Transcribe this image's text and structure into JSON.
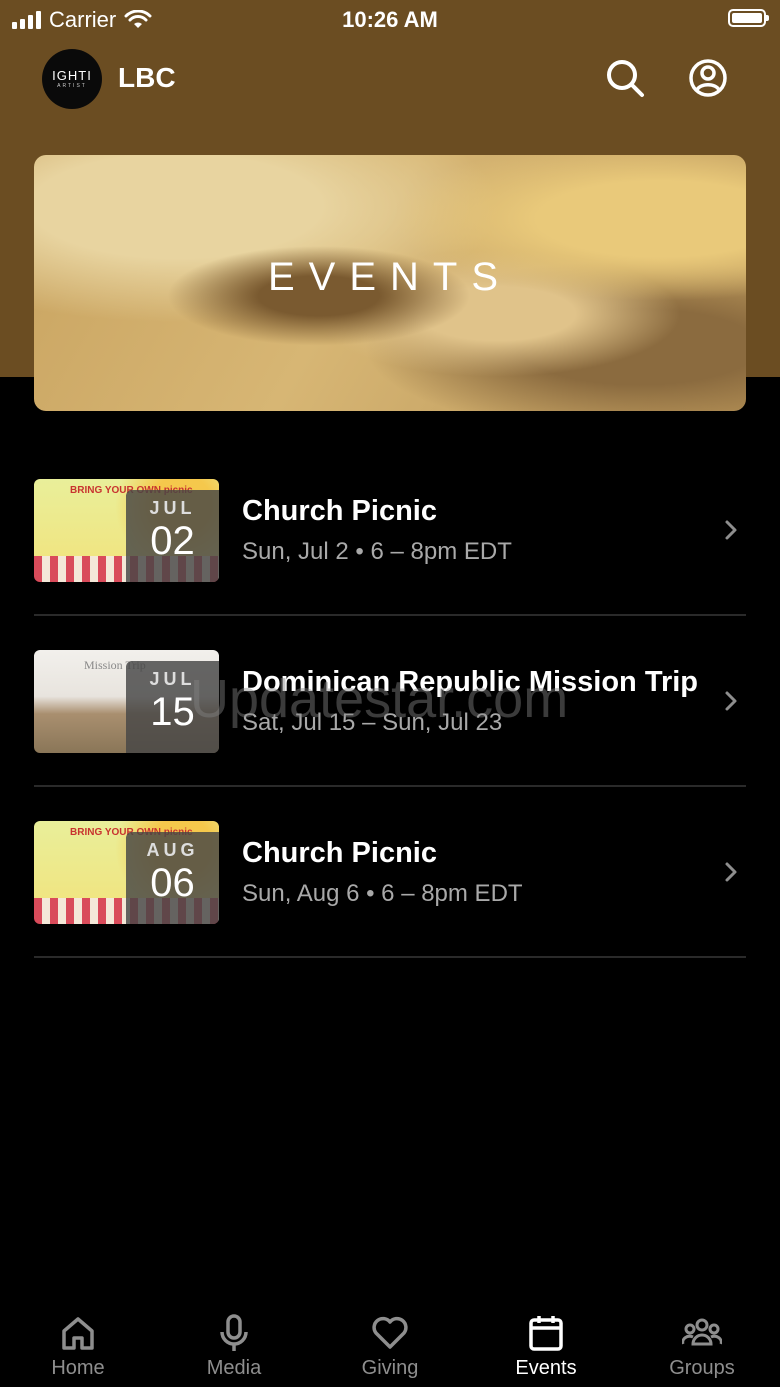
{
  "status_bar": {
    "carrier": "Carrier",
    "time": "10:26 AM"
  },
  "app_bar": {
    "logo_text": "IGHTI",
    "logo_subtext": "ARTIST",
    "title": "LBC",
    "search_icon": "search-icon",
    "profile_icon": "user-circle-icon"
  },
  "banner": {
    "title": "EVENTS"
  },
  "events": [
    {
      "title": "Church Picnic",
      "subtitle": "Sun, Jul 2 • 6 – 8pm EDT",
      "month": "JUL",
      "day": "02",
      "thumb_text": "BRING YOUR OWN picnic"
    },
    {
      "title": "Dominican Republic Mission Trip",
      "subtitle": "Sat, Jul 15 – Sun, Jul 23",
      "month": "JUL",
      "day": "15",
      "thumb_text": "Mission Trip"
    },
    {
      "title": "Church Picnic",
      "subtitle": "Sun, Aug 6 • 6 – 8pm EDT",
      "month": "AUG",
      "day": "06",
      "thumb_text": "BRING YOUR OWN picnic"
    }
  ],
  "watermark": "Updatestar.com",
  "tabs": [
    {
      "label": "Home",
      "icon": "home-icon",
      "active": false
    },
    {
      "label": "Media",
      "icon": "microphone-icon",
      "active": false
    },
    {
      "label": "Giving",
      "icon": "heart-icon",
      "active": false
    },
    {
      "label": "Events",
      "icon": "calendar-icon",
      "active": true
    },
    {
      "label": "Groups",
      "icon": "group-icon",
      "active": false
    }
  ],
  "colors": {
    "header": "#6b4d22",
    "background": "#000000",
    "subtitle": "#a9a9a9",
    "tab_inactive": "#8e8e8e"
  }
}
